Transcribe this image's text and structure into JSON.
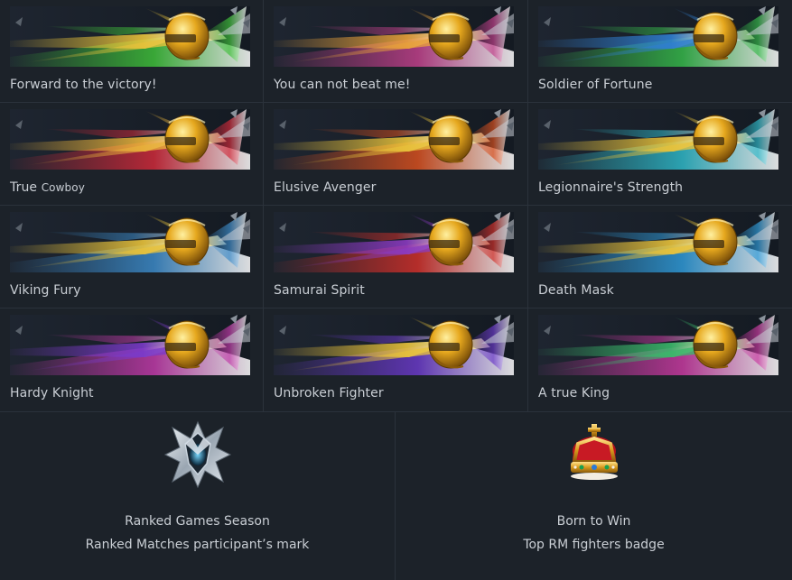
{
  "marks": [
    {
      "label": "Forward to the victory!",
      "icon": "helmet-icon",
      "accent": "#3fbf3a",
      "accent2": "#e8c23a"
    },
    {
      "label": "You can not beat me!",
      "icon": "headdress-icon",
      "accent": "#c0408a",
      "accent2": "#e8a13a"
    },
    {
      "label": "Soldier of Fortune",
      "icon": "crested-helmet-icon",
      "accent": "#36b84a",
      "accent2": "#2f7ed0"
    },
    {
      "label": "True",
      "label_small": "Cowboy",
      "icon": "cowboy-hat-icon",
      "accent": "#d02a3a",
      "accent2": "#e8b23a"
    },
    {
      "label": "Elusive Avenger",
      "icon": "visor-helmet-icon",
      "accent": "#d8501f",
      "accent2": "#e8c23a"
    },
    {
      "label": "Legionnaire's Strength",
      "icon": "spiked-helmet-icon",
      "accent": "#2fb8c8",
      "accent2": "#e8c23a"
    },
    {
      "label": "Viking Fury",
      "icon": "viking-helmet-icon",
      "accent": "#3c8ac8",
      "accent2": "#e8c23a"
    },
    {
      "label": "Samurai Spirit",
      "icon": "samurai-helmet-icon",
      "accent": "#d0302a",
      "accent2": "#8a3ac0"
    },
    {
      "label": "Death Mask",
      "icon": "skull-mask-icon",
      "accent": "#2f9ad8",
      "accent2": "#e8c23a"
    },
    {
      "label": "Hardy Knight",
      "icon": "knight-helmet-icon",
      "accent": "#c03aa8",
      "accent2": "#7a3ac8"
    },
    {
      "label": "Unbroken Fighter",
      "icon": "mask-icon",
      "accent": "#6a3ac8",
      "accent2": "#e8c23a"
    },
    {
      "label": "A true King",
      "icon": "crowned-helmet-icon",
      "accent": "#c83aa0",
      "accent2": "#3ab86a"
    }
  ],
  "badges": [
    {
      "title": "Ranked Games Season",
      "subtitle": "Ranked Matches participant’s mark",
      "icon": "ranked-emblem-icon"
    },
    {
      "title": "Born to Win",
      "subtitle": "Top RM fighters badge",
      "icon": "crown-icon"
    }
  ]
}
